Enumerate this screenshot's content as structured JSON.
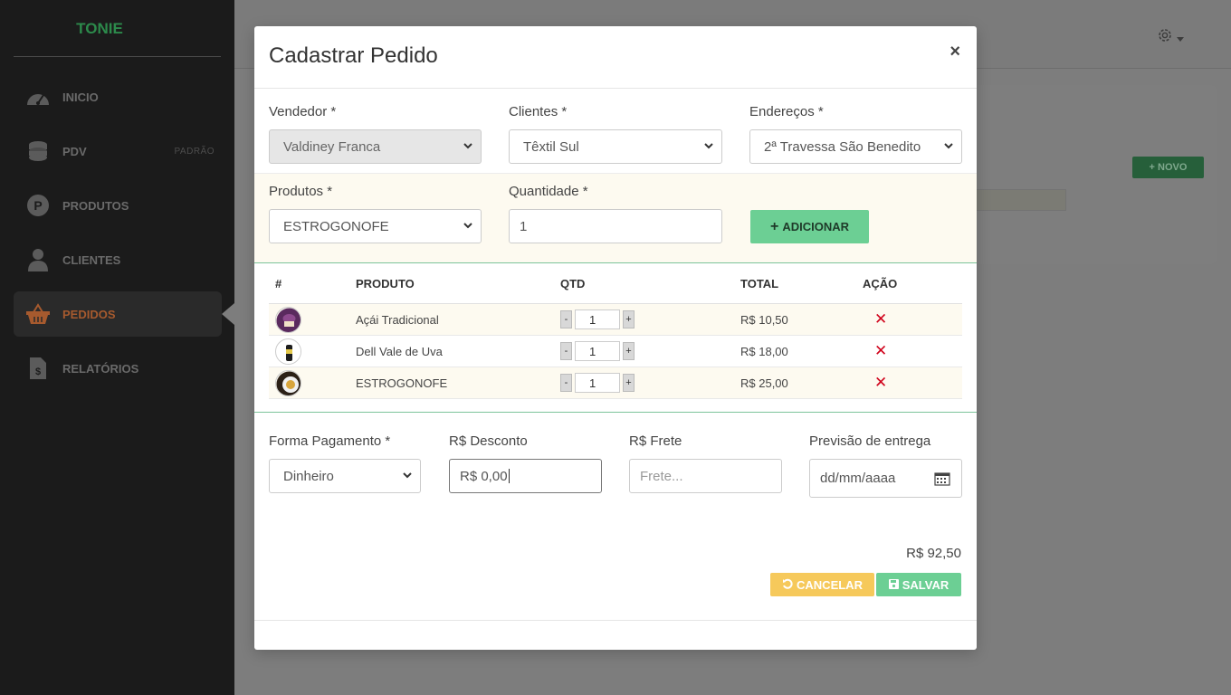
{
  "sidebar": {
    "brand": "TONIE",
    "items": [
      {
        "label": "INICIO",
        "icon": "dashboard-icon"
      },
      {
        "label": "PDV",
        "icon": "coins-icon",
        "badge": "PADRÃO"
      },
      {
        "label": "PRODUTOS",
        "icon": "product-p-icon"
      },
      {
        "label": "CLIENTES",
        "icon": "user-icon"
      },
      {
        "label": "PEDIDOS",
        "icon": "basket-icon",
        "active": true
      },
      {
        "label": "RELATÓRIOS",
        "icon": "report-icon"
      }
    ]
  },
  "background": {
    "novo_label": "NOVO"
  },
  "modal": {
    "title": "Cadastrar Pedido",
    "close": "×",
    "vendedor": {
      "label": "Vendedor *",
      "value": "Valdiney Franca"
    },
    "clientes": {
      "label": "Clientes *",
      "value": "Têxtil Sul"
    },
    "enderecos": {
      "label": "Endereços *",
      "value": "2ª Travessa São Benedito"
    },
    "produtos": {
      "label": "Produtos *",
      "value": "ESTROGONOFE"
    },
    "quantidade": {
      "label": "Quantidade *",
      "value": "1"
    },
    "add_label": "ADICIONAR",
    "table": {
      "headers": [
        "#",
        "PRODUTO",
        "QTD",
        "TOTAL",
        "AÇÃO"
      ],
      "rows": [
        {
          "product": "Açái Tradicional",
          "qty": "1",
          "total": "R$ 10,50"
        },
        {
          "product": "Dell Vale de Uva",
          "qty": "1",
          "total": "R$ 18,00"
        },
        {
          "product": "ESTROGONOFE",
          "qty": "1",
          "total": "R$ 25,00"
        }
      ],
      "minus": "-",
      "plus": "+"
    },
    "pagamento": {
      "label": "Forma Pagamento *",
      "value": "Dinheiro"
    },
    "desconto": {
      "label": "R$ Desconto",
      "value": "R$ 0,00"
    },
    "frete": {
      "label": "R$ Frete",
      "placeholder": "Frete..."
    },
    "previsao": {
      "label": "Previsão de entrega",
      "placeholder": "dd/mm/aaaa"
    },
    "total": "R$ 92,50",
    "cancel_label": "CANCELAR",
    "save_label": "SALVAR"
  },
  "colors": {
    "accent_green": "#6ccf94",
    "cancel_yellow": "#f6c95b",
    "delete_red": "#d0021b",
    "active_nav": "#a65a2e"
  }
}
